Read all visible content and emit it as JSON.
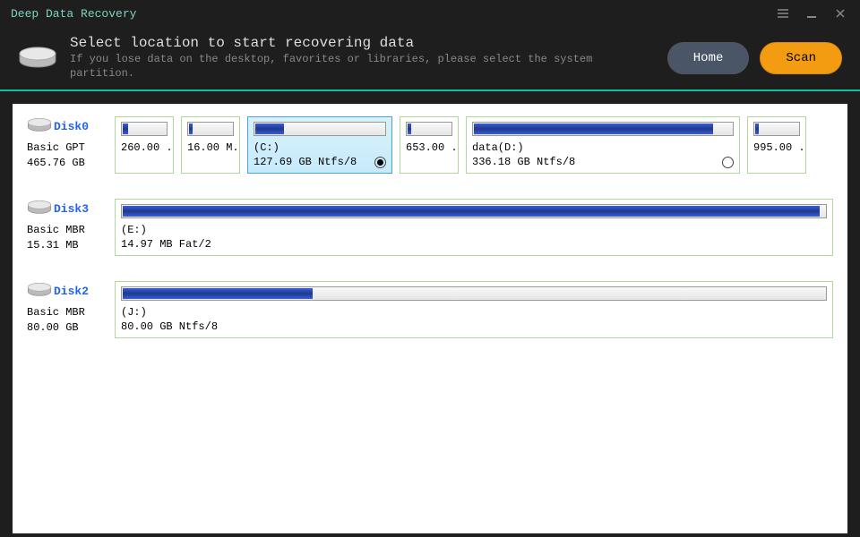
{
  "app": {
    "title": "Deep Data Recovery"
  },
  "header": {
    "title": "Select location to start recovering data",
    "subtitle": "If you lose data on the desktop, favorites or libraries, please select the system partition."
  },
  "buttons": {
    "home": "Home",
    "scan": "Scan"
  },
  "disks": [
    {
      "name": "Disk0",
      "type": "Basic GPT",
      "size": "465.76 GB",
      "partitions": [
        {
          "label": "",
          "sub": "260.00 .",
          "fillPct": 12,
          "widthPx": 66,
          "selected": false,
          "hasRadio": true
        },
        {
          "label": "",
          "sub": "16.00 M.",
          "fillPct": 8,
          "widthPx": 66,
          "selected": false,
          "hasRadio": true
        },
        {
          "label": "(C:)",
          "sub": "127.69 GB Ntfs/8",
          "fillPct": 22,
          "widthPx": 162,
          "selected": true,
          "hasRadio": true
        },
        {
          "label": "",
          "sub": "653.00 .",
          "fillPct": 8,
          "widthPx": 66,
          "selected": false,
          "hasRadio": true
        },
        {
          "label": "data(D:)",
          "sub": "336.18 GB Ntfs/8",
          "fillPct": 92,
          "widthPx": 306,
          "selected": false,
          "hasRadio": true
        },
        {
          "label": "",
          "sub": "995.00 .",
          "fillPct": 8,
          "widthPx": 66,
          "selected": false,
          "hasRadio": true
        }
      ]
    },
    {
      "name": "Disk3",
      "type": "Basic MBR",
      "size": "15.31 MB",
      "partitions": [
        {
          "label": "(E:)",
          "sub": "14.97 MB Fat/2",
          "fillPct": 99,
          "wide": true,
          "selected": false,
          "hasRadio": false
        }
      ]
    },
    {
      "name": "Disk2",
      "type": "Basic MBR",
      "size": "80.00 GB",
      "partitions": [
        {
          "label": "(J:)",
          "sub": "80.00 GB Ntfs/8",
          "fillPct": 27,
          "wide": true,
          "selected": false,
          "hasRadio": false
        }
      ]
    }
  ]
}
